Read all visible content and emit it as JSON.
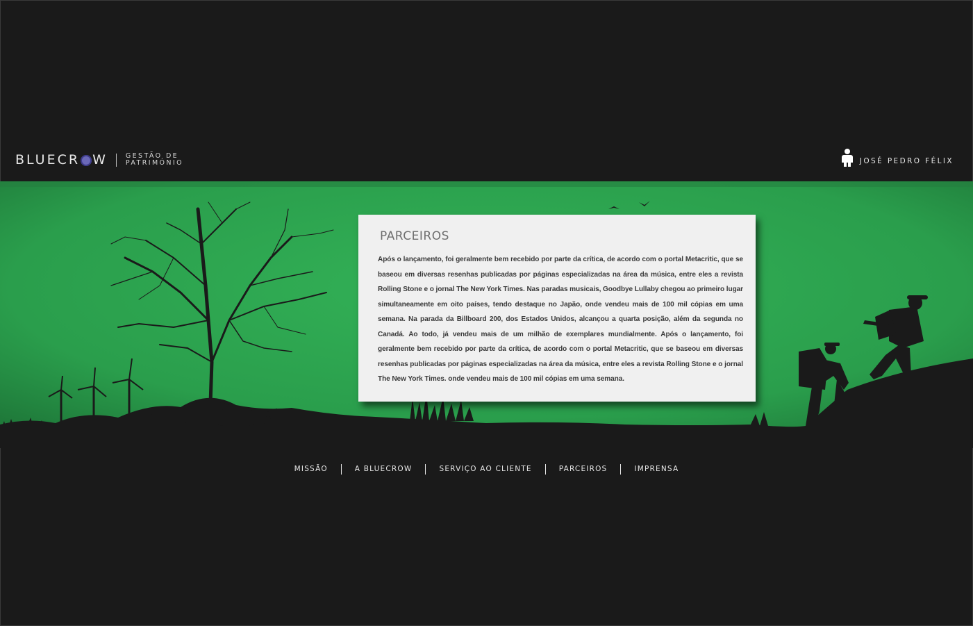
{
  "header": {
    "logo_word_left": "BLUECR",
    "logo_word_right": "W",
    "logo_subtitle_line1": "GESTÃO DE",
    "logo_subtitle_line2": "PATRIMÓNIO",
    "user_name": "JOSÉ PEDRO FÉLIX",
    "user_icon": "user-icon"
  },
  "content": {
    "title": "PARCEIROS",
    "body": "Após o lançamento, foi geralmente bem recebido por parte da crítica, de acordo com o portal Metacritic, que se baseou em diversas resenhas publicadas por páginas especializadas na área da música, entre eles a revista Rolling Stone e o jornal The New York Times. Nas paradas musicais, Goodbye Lullaby chegou ao primeiro lugar simultaneamente em oito países, tendo destaque no Japão, onde vendeu mais de 100 mil cópias em uma semana. Na parada da Billboard 200, dos Estados Unidos, alcançou a quarta posição, além da segunda no Canadá. Ao todo, já vendeu mais de um milhão de exemplares mundialmente. Após o lançamento, foi geralmente bem recebido por parte da crítica, de acordo com o portal Metacritic, que se baseou em diversas resenhas publicadas por páginas especializadas na área da música, entre eles a revista Rolling Stone e o jornal The New York Times. onde vendeu mais de 100 mil cópias em uma semana."
  },
  "nav": {
    "items": [
      {
        "label": "MISSÃO"
      },
      {
        "label": "A BLUECROW"
      },
      {
        "label": "SERVIÇO AO CLIENTE"
      },
      {
        "label": "PARCEIROS"
      },
      {
        "label": "IMPRENSA"
      }
    ]
  },
  "colors": {
    "background": "#1a1a1a",
    "banner_green": "#2fa650",
    "silhouette": "#1a1a1a",
    "card": "#f0f0f0",
    "logo_accent": "#6b69b8"
  }
}
